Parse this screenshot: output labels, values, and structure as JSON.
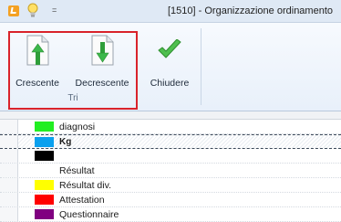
{
  "window": {
    "title": "[1510] - Organizzazione ordinamento",
    "qat_dropdown": "="
  },
  "ribbon": {
    "buttons": [
      {
        "label": "Crescente",
        "icon": "sort-ascending-icon"
      },
      {
        "label": "Decrescente",
        "icon": "sort-descending-icon"
      },
      {
        "label": "Chiudere",
        "icon": "checkmark-icon"
      }
    ],
    "group_label": "Tri",
    "colors": {
      "accent_green": "#3aa63a",
      "highlight_red": "#d9232b"
    }
  },
  "grid": {
    "rows": [
      {
        "name": "diagnosi",
        "color": "#22ee22",
        "selected": false
      },
      {
        "name": "Kg",
        "color": "#0aa0ee",
        "selected": true
      },
      {
        "name": "",
        "color": "#000000",
        "selected": false
      },
      {
        "name": "Résultat",
        "color": "#ffffff",
        "selected": false
      },
      {
        "name": "Résultat div.",
        "color": "#ffff00",
        "selected": false
      },
      {
        "name": "Attestation",
        "color": "#ff0000",
        "selected": false
      },
      {
        "name": "Questionnaire",
        "color": "#800080",
        "selected": false
      }
    ]
  }
}
